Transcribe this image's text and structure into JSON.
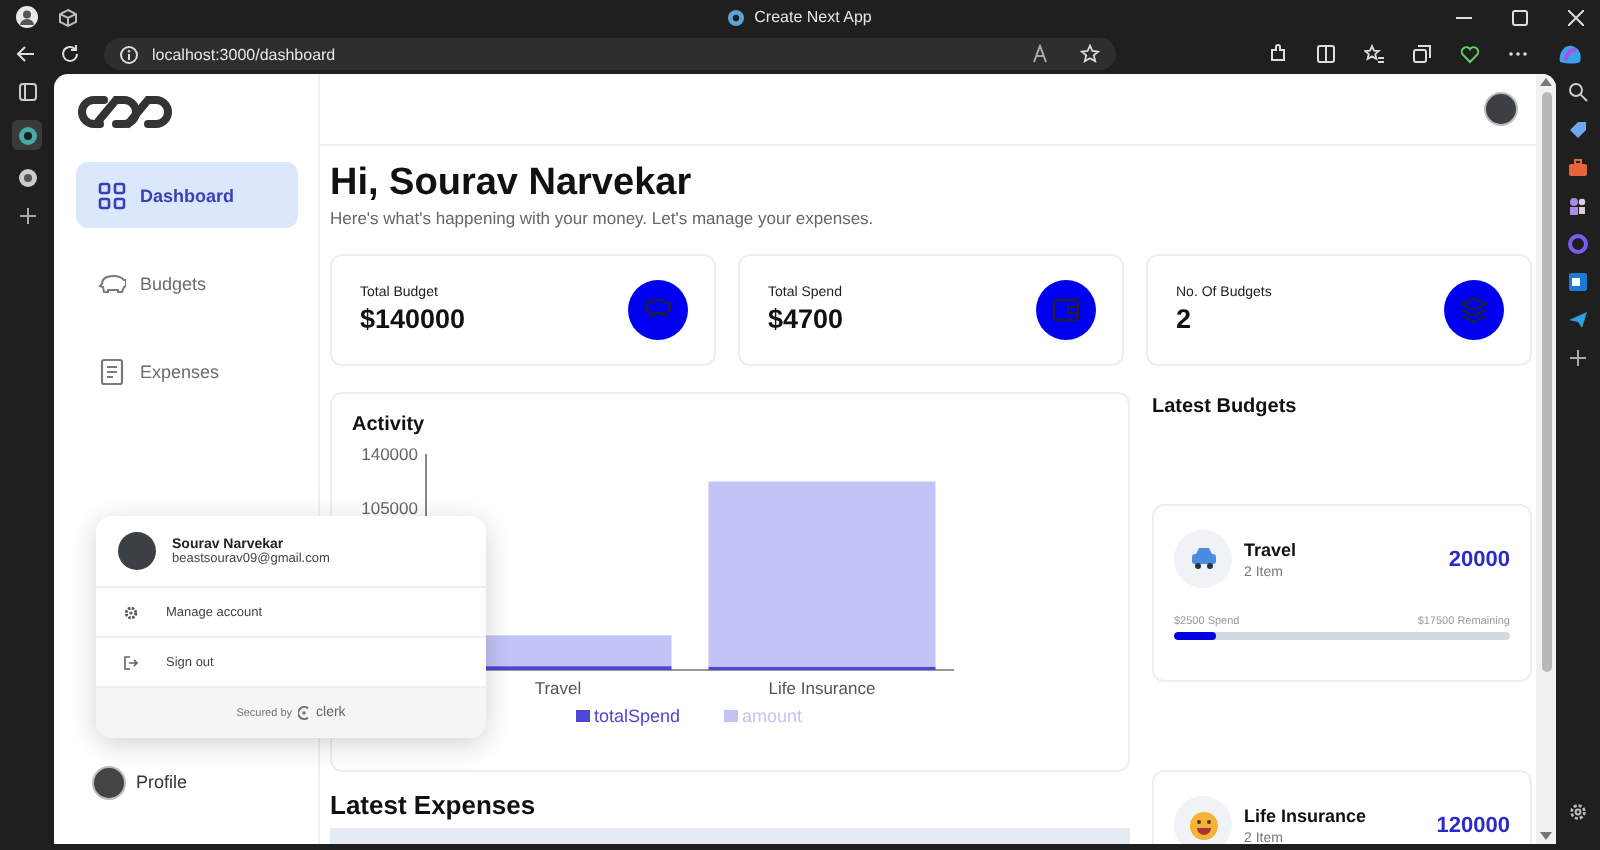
{
  "browser": {
    "title": "Create Next App",
    "url": "localhost:3000/dashboard"
  },
  "sidebar": {
    "items": [
      {
        "kind": "dashboard",
        "label": "Dashboard",
        "selected": true
      },
      {
        "kind": "budgets",
        "label": "Budgets",
        "selected": false
      },
      {
        "kind": "expenses",
        "label": "Expenses",
        "selected": false
      }
    ],
    "profile": "Profile"
  },
  "user_menu": {
    "name": "Sourav Narvekar",
    "email": "beastsourav09@gmail.com",
    "actions": [
      {
        "kind": "settings",
        "label": "Manage account"
      },
      {
        "kind": "signout",
        "label": "Sign out"
      }
    ],
    "footer": "Secured by",
    "brand": "clerk"
  },
  "greeting": {
    "title": "Hi, Sourav Narvekar",
    "subtitle": "Here's what's happening with your money. Let's manage your expenses."
  },
  "stats": [
    {
      "kind": "budget",
      "label": "Total Budget",
      "value": "$140000"
    },
    {
      "kind": "spend",
      "label": "Total Spend",
      "value": "$4700"
    },
    {
      "kind": "count",
      "label": "No. Of Budgets",
      "value": "2"
    }
  ],
  "activity": {
    "title": "Activity",
    "chart_data": {
      "type": "bar",
      "stacked": true,
      "legend": "bottom",
      "categories": [
        "Travel",
        "Life Insurance"
      ],
      "ylim": [
        0,
        140000
      ],
      "yticks": [
        105000,
        140000
      ],
      "series": [
        {
          "name": "totalSpend",
          "color": "#4b48d6",
          "values": [
            2500,
            2200
          ]
        },
        {
          "name": "amount",
          "color": "#c4c3f7",
          "values": [
            20000,
            120000
          ]
        }
      ]
    }
  },
  "latest_budgets": {
    "title": "Latest Budgets",
    "items": [
      {
        "kind": "car",
        "name": "Travel",
        "count": "2 Item",
        "amount": "20000",
        "spend": "$2500 Spend",
        "remaining": "$17500 Remaining",
        "level": 0.125
      },
      {
        "kind": "smiley",
        "name": "Life Insurance",
        "count": "2 Item",
        "amount": "120000"
      }
    ]
  },
  "latest_expenses": {
    "title": "Latest Expenses"
  }
}
